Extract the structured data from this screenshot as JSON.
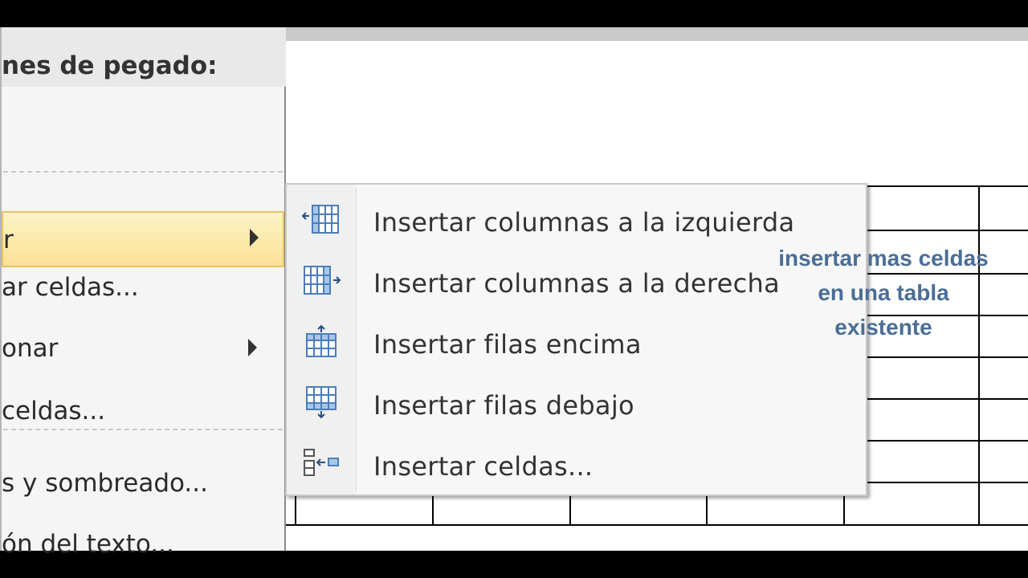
{
  "context_menu": {
    "header": "nes de pegado:",
    "items": [
      {
        "label": "r",
        "has_submenu": true,
        "highlighted": true
      },
      {
        "label": "ar celdas...",
        "has_submenu": false
      },
      {
        "label": "onar",
        "has_submenu": true
      },
      {
        "label": " celdas...",
        "has_submenu": false
      },
      {
        "label": "s y sombreado...",
        "has_submenu": false
      },
      {
        "label": "ón del texto...",
        "has_submenu": false
      }
    ]
  },
  "submenu": {
    "items": [
      {
        "label": "Insertar columnas a la izquierda",
        "icon": "insert-column-left-icon"
      },
      {
        "label": "Insertar columnas a la derecha",
        "icon": "insert-column-right-icon"
      },
      {
        "label": "Insertar filas encima",
        "icon": "insert-row-above-icon"
      },
      {
        "label": "Insertar filas debajo",
        "icon": "insert-row-below-icon"
      },
      {
        "label": "Insertar celdas...",
        "icon": "insert-cells-icon"
      }
    ]
  },
  "annotation": {
    "lines": [
      "insertar mas celdas",
      "en una tabla",
      "existente"
    ],
    "color": "#4a6e95"
  },
  "colors": {
    "highlight": "#fbe196",
    "icon_blue": "#4a7ebb"
  }
}
